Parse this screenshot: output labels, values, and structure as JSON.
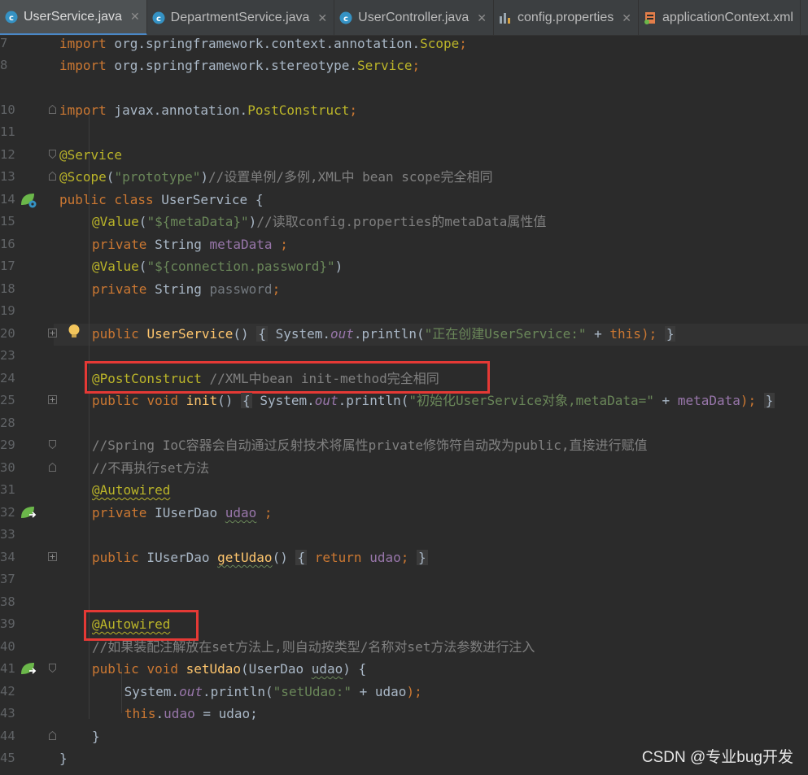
{
  "tabs": [
    {
      "label": "UserService.java",
      "icon": "class-icon",
      "active": true
    },
    {
      "label": "DepartmentService.java",
      "icon": "class-icon",
      "active": false
    },
    {
      "label": "UserController.java",
      "icon": "class-icon",
      "active": false
    },
    {
      "label": "config.properties",
      "icon": "properties-file-icon",
      "active": false
    },
    {
      "label": "applicationContext.xml",
      "icon": "xml-file-icon",
      "active": false
    }
  ],
  "lines": {
    "l7": "7",
    "l8": "8",
    "l10": "10",
    "l11": "11",
    "l12": "12",
    "l13": "13",
    "l14": "14",
    "l15": "15",
    "l16": "16",
    "l17": "17",
    "l18": "18",
    "l19": "19",
    "l20": "20",
    "l23": "23",
    "l24": "24",
    "l25": "25",
    "l28": "28",
    "l29": "29",
    "l30": "30",
    "l31": "31",
    "l32": "32",
    "l33": "33",
    "l34": "34",
    "l37": "37",
    "l38": "38",
    "l39": "39",
    "l40": "40",
    "l41": "41",
    "l42": "42",
    "l43": "43",
    "l44": "44",
    "l45": "45"
  },
  "code": {
    "t_import": "import",
    "t_pkg_scope": " org.springframework.context.annotation.",
    "t_scope": "Scope",
    "t_semi": ";",
    "t_pkg_stereo": " org.springframework.stereotype.",
    "t_service": "Service",
    "t_pkg_javax": " javax.annotation.",
    "t_postconstruct": "PostConstruct",
    "a_service": "@Service",
    "a_scope": "@Scope",
    "t_lp": "(",
    "s_prototype": "\"prototype\"",
    "t_rp": ")",
    "c_13": "//设置单例/多例,XML中 bean scope完全相同",
    "k_public_class": "public class",
    "t_userservice_decl": " UserService {",
    "a_value": "@Value",
    "s_metadata": "\"${metaData}\"",
    "c_15": "//读取config.properties的metaData属性值",
    "k_private": "private",
    "t_string": " String ",
    "f_metadata": "metaData",
    "t_sp_semi": " ;",
    "s_conn_pwd": "\"${connection.password}\"",
    "f_password": "password",
    "k_public": "public",
    "m_userservice": "UserService",
    "t_parens": "()",
    "t_ob": "{",
    "t_system": " System.",
    "f_out": "out",
    "t_println": ".println(",
    "s_creating": "\"正在创建UserService:\"",
    "t_plus": " + ",
    "k_this": "this",
    "t_rp_semi": ");",
    "t_cb": "}",
    "a_postconstruct": "@PostConstruct",
    "c_24": " //XML中bean init-method完全相同",
    "k_void": "void",
    "m_init": "init",
    "s_init_msg": "\"初始化UserService对象,metaData=\"",
    "c_29": "//Spring IoC容器会自动通过反射技术将属性private修饰符自动改为public,直接进行赋值",
    "c_30": "//不再执行set方法",
    "a_autowired": "@Autowired",
    "t_iuserdao": " IUserDao ",
    "f_udao": "udao",
    "m_getudao": "getUdao",
    "k_return": "return",
    "c_40": "//如果装配注解放在set方法上,则自动按类型/名称对set方法参数进行注入",
    "m_setudao": "setUdao",
    "t_userdao_param": "(UserDao ",
    "t_param_udao": "udao",
    "t_rp_ob": ") {",
    "s_setudao": "\"setUdao:\"",
    "t_udao_plain": "udao",
    "t_dot": ".",
    "t_assign": " = ",
    "t_udao_semi": "udao;"
  },
  "watermark": "CSDN @专业bug开发",
  "colors": {
    "background": "#2b2b2b",
    "keyword": "#cc7832",
    "annotation": "#bbb529",
    "string": "#6a8759",
    "comment": "#808080",
    "field": "#9876aa",
    "method": "#ffc66d",
    "highlight_box": "#e53935"
  }
}
